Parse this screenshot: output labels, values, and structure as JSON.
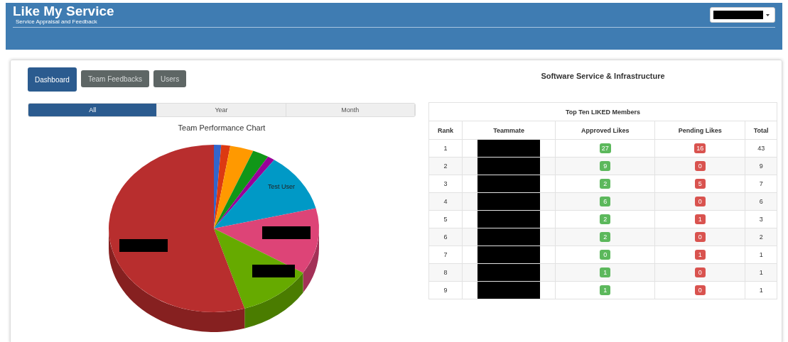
{
  "header": {
    "title": "Like My Service",
    "subtitle": "Service Appraisal and Feedback",
    "user_menu": {
      "redacted": true
    }
  },
  "nav_tabs": [
    {
      "label": "Dashboard",
      "selected": true
    },
    {
      "label": "Team Feedbacks",
      "selected": false
    },
    {
      "label": "Users",
      "selected": false
    }
  ],
  "page_title": "Software Service & Infrastructure",
  "period_tabs": [
    {
      "label": "All",
      "selected": true
    },
    {
      "label": "Year",
      "selected": false
    },
    {
      "label": "Month",
      "selected": false
    }
  ],
  "chart": {
    "title": "Team Performance Chart",
    "slice_labels": [
      {
        "text": "Test User",
        "redacted": false
      },
      {
        "redacted": true
      },
      {
        "redacted": true
      },
      {
        "redacted": true
      }
    ]
  },
  "table": {
    "title": "Top Ten LIKED Members",
    "columns": [
      "Rank",
      "Teammate",
      "Approved Likes",
      "Pending Likes",
      "Total"
    ],
    "rows": [
      {
        "rank": "1",
        "teammate_redacted": true,
        "approved": "27",
        "pending": "16",
        "total": "43"
      },
      {
        "rank": "2",
        "teammate_redacted": true,
        "approved": "9",
        "pending": "0",
        "total": "9"
      },
      {
        "rank": "3",
        "teammate_redacted": true,
        "approved": "2",
        "pending": "5",
        "total": "7"
      },
      {
        "rank": "4",
        "teammate_redacted": true,
        "approved": "6",
        "pending": "0",
        "total": "6"
      },
      {
        "rank": "5",
        "teammate_redacted": true,
        "approved": "2",
        "pending": "1",
        "total": "3"
      },
      {
        "rank": "6",
        "teammate_redacted": true,
        "approved": "2",
        "pending": "0",
        "total": "2"
      },
      {
        "rank": "7",
        "teammate_redacted": true,
        "approved": "0",
        "pending": "1",
        "total": "1"
      },
      {
        "rank": "8",
        "teammate_redacted": true,
        "approved": "1",
        "pending": "0",
        "total": "1"
      },
      {
        "rank": "9",
        "teammate_redacted": true,
        "approved": "1",
        "pending": "0",
        "total": "1"
      }
    ]
  }
}
